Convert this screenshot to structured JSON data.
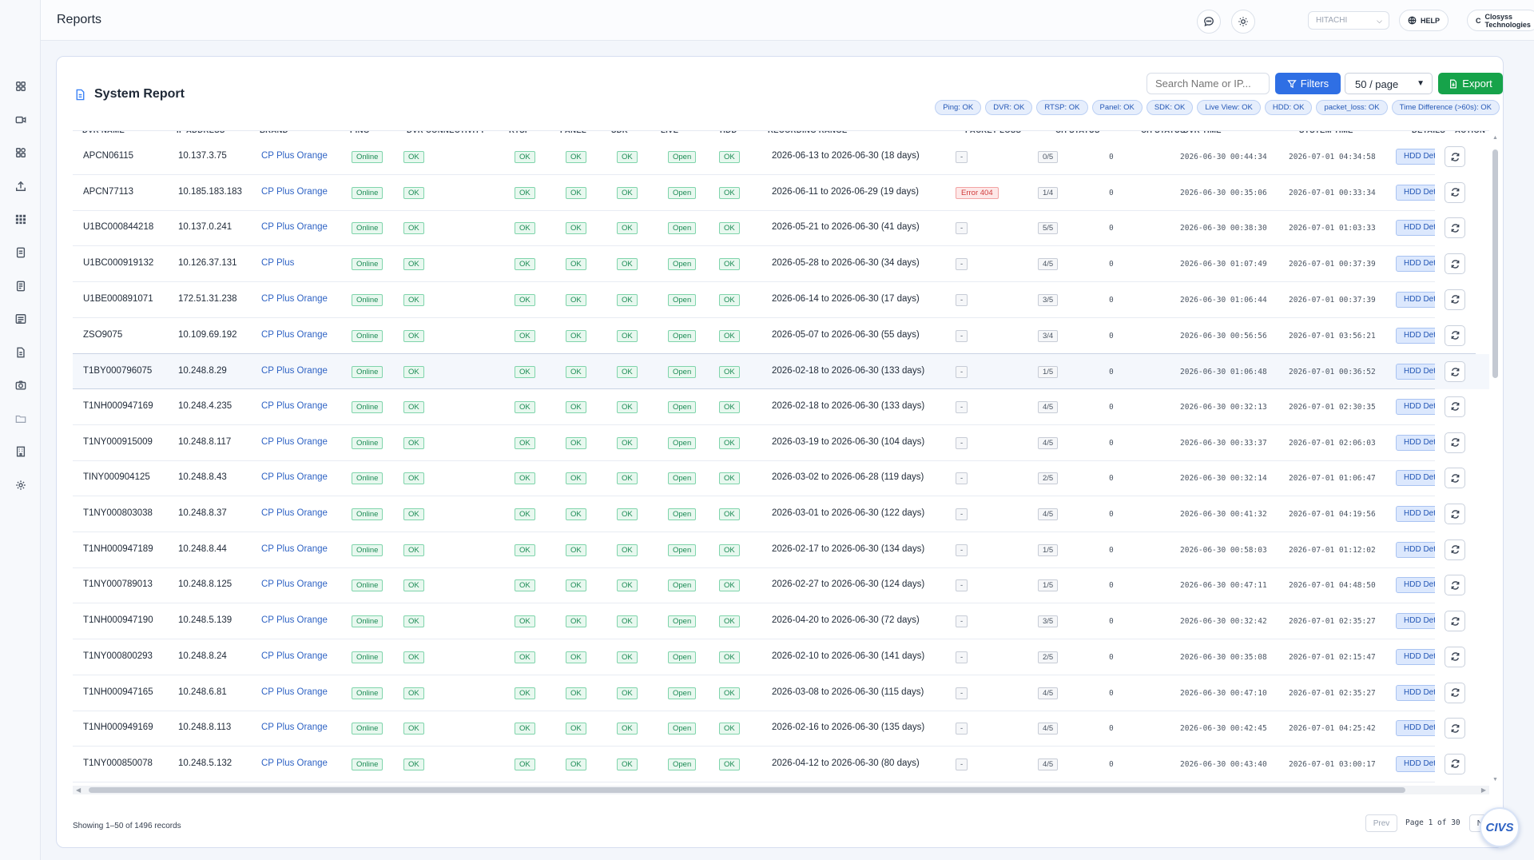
{
  "header": {
    "title": "Reports",
    "brand_select": "HITACHI",
    "help_label": "HELP",
    "company_initial": "C",
    "company_label": "Closyss Technologies"
  },
  "sidebar": {
    "items": [
      {
        "name": "dashboard-icon"
      },
      {
        "name": "camera-icon"
      },
      {
        "name": "apps-icon"
      },
      {
        "name": "upload-icon"
      },
      {
        "name": "grid-icon"
      },
      {
        "name": "document-icon"
      },
      {
        "name": "document-alt-icon"
      },
      {
        "name": "list-icon"
      },
      {
        "name": "file-icon"
      },
      {
        "name": "snapshot-icon"
      },
      {
        "name": "folder-icon"
      },
      {
        "name": "building-icon"
      },
      {
        "name": "settings-icon"
      }
    ]
  },
  "report": {
    "title": "System Report",
    "search_placeholder": "Search Name or IP...",
    "filters_label": "Filters",
    "per_page": "50 / page",
    "export_label": "Export",
    "chips": [
      "Ping: OK",
      "DVR: OK",
      "RTSP: OK",
      "Panel: OK",
      "SDK: OK",
      "Live View: OK",
      "HDD: OK",
      "packet_loss: OK",
      "Time Difference (>60s): OK"
    ],
    "columns": [
      "DVR NAME",
      "IP ADDRESS",
      "BRAND",
      "PING",
      "DVR CONNECTIVITY",
      "RTSP",
      "PANEL",
      "SDK",
      "LIVE",
      "HDD",
      "RECORDING RANGE",
      "PACKET LOSS",
      "CH STATUS",
      "CH STATUS",
      "DVR TIME",
      "SYSTEM TIME",
      "DETAILS",
      "ACTION"
    ],
    "hdd_button_label": "HDD Details",
    "rows": [
      {
        "name": "APCN06115",
        "ip": "10.137.3.75",
        "brand": "CP Plus Orange",
        "ping": "Online",
        "conn": "OK",
        "rtsp": "OK",
        "panel": "OK",
        "sdk": "OK",
        "live": "Open",
        "hdd": "OK",
        "range": "2026-06-13 to 2026-06-30 (18 days)",
        "loss": "-",
        "ch": "0/5",
        "ch2": "0",
        "dvr_time": "2026-06-30 00:44:34",
        "sys_time": "2026-07-01 04:34:58"
      },
      {
        "name": "APCN77113",
        "ip": "10.185.183.183",
        "brand": "CP Plus Orange",
        "ping": "Online",
        "conn": "OK",
        "rtsp": "OK",
        "panel": "OK",
        "sdk": "OK",
        "live": "Open",
        "hdd": "OK",
        "range": "2026-06-11 to 2026-06-29 (19 days)",
        "loss": "Error 404",
        "ch": "1/4",
        "ch2": "0",
        "dvr_time": "2026-06-30 00:35:06",
        "sys_time": "2026-07-01 00:33:34"
      },
      {
        "name": "U1BC000844218",
        "ip": "10.137.0.241",
        "brand": "CP Plus Orange",
        "ping": "Online",
        "conn": "OK",
        "rtsp": "OK",
        "panel": "OK",
        "sdk": "OK",
        "live": "Open",
        "hdd": "OK",
        "range": "2026-05-21 to 2026-06-30 (41 days)",
        "loss": "-",
        "ch": "5/5",
        "ch2": "0",
        "dvr_time": "2026-06-30 00:38:30",
        "sys_time": "2026-07-01 01:03:33"
      },
      {
        "name": "U1BC000919132",
        "ip": "10.126.37.131",
        "brand": "CP Plus",
        "ping": "Online",
        "conn": "OK",
        "rtsp": "OK",
        "panel": "OK",
        "sdk": "OK",
        "live": "Open",
        "hdd": "OK",
        "range": "2026-05-28 to 2026-06-30 (34 days)",
        "loss": "-",
        "ch": "4/5",
        "ch2": "0",
        "dvr_time": "2026-06-30 01:07:49",
        "sys_time": "2026-07-01 00:37:39"
      },
      {
        "name": "U1BE000891071",
        "ip": "172.51.31.238",
        "brand": "CP Plus Orange",
        "ping": "Online",
        "conn": "OK",
        "rtsp": "OK",
        "panel": "OK",
        "sdk": "OK",
        "live": "Open",
        "hdd": "OK",
        "range": "2026-06-14 to 2026-06-30 (17 days)",
        "loss": "-",
        "ch": "3/5",
        "ch2": "0",
        "dvr_time": "2026-06-30 01:06:44",
        "sys_time": "2026-07-01 00:37:39"
      },
      {
        "name": "ZSO9075",
        "ip": "10.109.69.192",
        "brand": "CP Plus Orange",
        "ping": "Online",
        "conn": "OK",
        "rtsp": "OK",
        "panel": "OK",
        "sdk": "OK",
        "live": "Open",
        "hdd": "OK",
        "range": "2026-05-07 to 2026-06-30 (55 days)",
        "loss": "-",
        "ch": "3/4",
        "ch2": "0",
        "dvr_time": "2026-06-30 00:56:56",
        "sys_time": "2026-07-01 03:56:21"
      },
      {
        "name": "T1BY000796075",
        "ip": "10.248.8.29",
        "brand": "CP Plus Orange",
        "ping": "Online",
        "conn": "OK",
        "rtsp": "OK",
        "panel": "OK",
        "sdk": "OK",
        "live": "Open",
        "hdd": "OK",
        "range": "2026-02-18 to 2026-06-30 (133 days)",
        "loss": "-",
        "ch": "1/5",
        "ch2": "0",
        "dvr_time": "2026-06-30 01:06:48",
        "sys_time": "2026-07-01 00:36:52"
      },
      {
        "name": "T1NH000947169",
        "ip": "10.248.4.235",
        "brand": "CP Plus Orange",
        "ping": "Online",
        "conn": "OK",
        "rtsp": "OK",
        "panel": "OK",
        "sdk": "OK",
        "live": "Open",
        "hdd": "OK",
        "range": "2026-02-18 to 2026-06-30 (133 days)",
        "loss": "-",
        "ch": "4/5",
        "ch2": "0",
        "dvr_time": "2026-06-30 00:32:13",
        "sys_time": "2026-07-01 02:30:35"
      },
      {
        "name": "T1NY000915009",
        "ip": "10.248.8.117",
        "brand": "CP Plus Orange",
        "ping": "Online",
        "conn": "OK",
        "rtsp": "OK",
        "panel": "OK",
        "sdk": "OK",
        "live": "Open",
        "hdd": "OK",
        "range": "2026-03-19 to 2026-06-30 (104 days)",
        "loss": "-",
        "ch": "4/5",
        "ch2": "0",
        "dvr_time": "2026-06-30 00:33:37",
        "sys_time": "2026-07-01 02:06:03"
      },
      {
        "name": "TINY000904125",
        "ip": "10.248.8.43",
        "brand": "CP Plus Orange",
        "ping": "Online",
        "conn": "OK",
        "rtsp": "OK",
        "panel": "OK",
        "sdk": "OK",
        "live": "Open",
        "hdd": "OK",
        "range": "2026-03-02 to 2026-06-28 (119 days)",
        "loss": "-",
        "ch": "2/5",
        "ch2": "0",
        "dvr_time": "2026-06-30 00:32:14",
        "sys_time": "2026-07-01 01:06:47"
      },
      {
        "name": "T1NY000803038",
        "ip": "10.248.8.37",
        "brand": "CP Plus Orange",
        "ping": "Online",
        "conn": "OK",
        "rtsp": "OK",
        "panel": "OK",
        "sdk": "OK",
        "live": "Open",
        "hdd": "OK",
        "range": "2026-03-01 to 2026-06-30 (122 days)",
        "loss": "-",
        "ch": "4/5",
        "ch2": "0",
        "dvr_time": "2026-06-30 00:41:32",
        "sys_time": "2026-07-01 04:19:56"
      },
      {
        "name": "T1NH000947189",
        "ip": "10.248.8.44",
        "brand": "CP Plus Orange",
        "ping": "Online",
        "conn": "OK",
        "rtsp": "OK",
        "panel": "OK",
        "sdk": "OK",
        "live": "Open",
        "hdd": "OK",
        "range": "2026-02-17 to 2026-06-30 (134 days)",
        "loss": "-",
        "ch": "1/5",
        "ch2": "0",
        "dvr_time": "2026-06-30 00:58:03",
        "sys_time": "2026-07-01 01:12:02"
      },
      {
        "name": "T1NY000789013",
        "ip": "10.248.8.125",
        "brand": "CP Plus Orange",
        "ping": "Online",
        "conn": "OK",
        "rtsp": "OK",
        "panel": "OK",
        "sdk": "OK",
        "live": "Open",
        "hdd": "OK",
        "range": "2026-02-27 to 2026-06-30 (124 days)",
        "loss": "-",
        "ch": "1/5",
        "ch2": "0",
        "dvr_time": "2026-06-30 00:47:11",
        "sys_time": "2026-07-01 04:48:50"
      },
      {
        "name": "T1NH000947190",
        "ip": "10.248.5.139",
        "brand": "CP Plus Orange",
        "ping": "Online",
        "conn": "OK",
        "rtsp": "OK",
        "panel": "OK",
        "sdk": "OK",
        "live": "Open",
        "hdd": "OK",
        "range": "2026-04-20 to 2026-06-30 (72 days)",
        "loss": "-",
        "ch": "3/5",
        "ch2": "0",
        "dvr_time": "2026-06-30 00:32:42",
        "sys_time": "2026-07-01 02:35:27"
      },
      {
        "name": "T1NY000800293",
        "ip": "10.248.8.24",
        "brand": "CP Plus Orange",
        "ping": "Online",
        "conn": "OK",
        "rtsp": "OK",
        "panel": "OK",
        "sdk": "OK",
        "live": "Open",
        "hdd": "OK",
        "range": "2026-02-10 to 2026-06-30 (141 days)",
        "loss": "-",
        "ch": "2/5",
        "ch2": "0",
        "dvr_time": "2026-06-30 00:35:08",
        "sys_time": "2026-07-01 02:15:47"
      },
      {
        "name": "T1NH000947165",
        "ip": "10.248.6.81",
        "brand": "CP Plus Orange",
        "ping": "Online",
        "conn": "OK",
        "rtsp": "OK",
        "panel": "OK",
        "sdk": "OK",
        "live": "Open",
        "hdd": "OK",
        "range": "2026-03-08 to 2026-06-30 (115 days)",
        "loss": "-",
        "ch": "4/5",
        "ch2": "0",
        "dvr_time": "2026-06-30 00:47:10",
        "sys_time": "2026-07-01 02:35:27"
      },
      {
        "name": "T1NH000949169",
        "ip": "10.248.8.113",
        "brand": "CP Plus Orange",
        "ping": "Online",
        "conn": "OK",
        "rtsp": "OK",
        "panel": "OK",
        "sdk": "OK",
        "live": "Open",
        "hdd": "OK",
        "range": "2026-02-16 to 2026-06-30 (135 days)",
        "loss": "-",
        "ch": "4/5",
        "ch2": "0",
        "dvr_time": "2026-06-30 00:42:45",
        "sys_time": "2026-07-01 04:25:42"
      },
      {
        "name": "T1NY000850078",
        "ip": "10.248.5.132",
        "brand": "CP Plus Orange",
        "ping": "Online",
        "conn": "OK",
        "rtsp": "OK",
        "panel": "OK",
        "sdk": "OK",
        "live": "Open",
        "hdd": "OK",
        "range": "2026-04-12 to 2026-06-30 (80 days)",
        "loss": "-",
        "ch": "4/5",
        "ch2": "0",
        "dvr_time": "2026-06-30 00:43:40",
        "sys_time": "2026-07-01 03:00:17"
      }
    ]
  },
  "footer": {
    "showing": "Showing 1–50 of 1496 records",
    "prev": "Prev",
    "page_label": "Page 1 of 30",
    "next": "Next",
    "logo_text": "CIVS"
  },
  "colors": {
    "primary": "#2f6fe4",
    "export": "#16a34a",
    "ok_badge": "#1b8a54",
    "error_badge": "#d03b3b"
  }
}
